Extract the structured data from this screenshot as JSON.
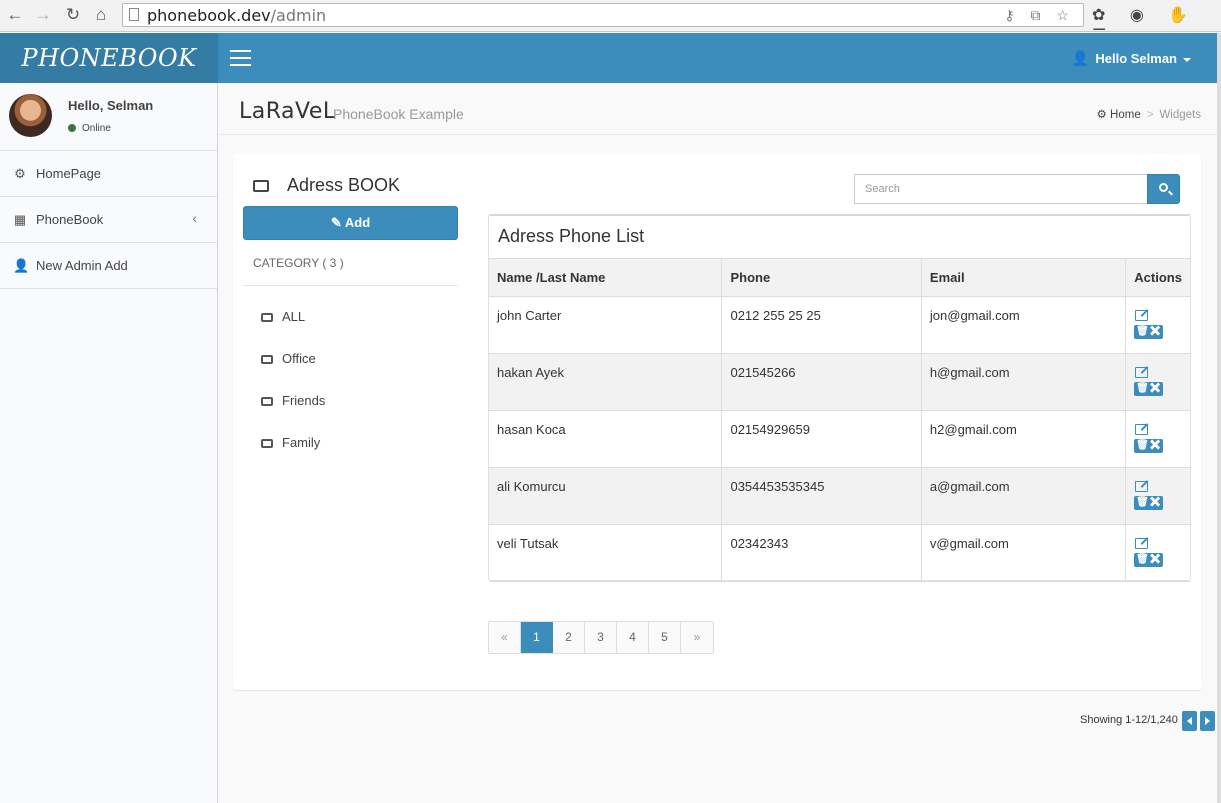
{
  "browser": {
    "url_host": "phonebook.dev",
    "url_path": "/admin",
    "back_icon": "←",
    "forward_icon": "→",
    "reload_icon": "↻",
    "home_icon": "⌂",
    "addr_icons": "⚷ ⧉ ☆",
    "ext_icons": "✿ ◉ ✋ ☰"
  },
  "header": {
    "logo": "PHONEBOOK",
    "user_greeting": "Hello Selman",
    "user_icon": "👤"
  },
  "sidebar": {
    "user_name": "Hello, Selman",
    "status": "Online",
    "items": [
      {
        "icon": "⚙",
        "label": "HomePage"
      },
      {
        "icon": "▦",
        "label": "PhoneBook",
        "chevron": "‹"
      },
      {
        "icon": "👤",
        "label": "New Admin Add"
      }
    ]
  },
  "content_header": {
    "title": "LaRaVeL",
    "subtitle": "PhoneBook Example",
    "breadcrumb_home": "Home",
    "breadcrumb_sep": ">",
    "breadcrumb_current": "Widgets"
  },
  "addressbook": {
    "title": "Adress BOOK",
    "add_label": "✎ Add",
    "category_label": "CATEGORY ( 3 )",
    "categories": [
      "ALL",
      "Office",
      "Friends",
      "Family"
    ]
  },
  "search": {
    "placeholder": "Search"
  },
  "list": {
    "title": "Adress Phone List",
    "columns": [
      "Name /Last Name",
      "Phone",
      "Email",
      "Actions"
    ],
    "rows": [
      {
        "name": "john Carter",
        "phone": "0212 255 25 25",
        "email": "jon@gmail.com"
      },
      {
        "name": "hakan Ayek",
        "phone": "021545266",
        "email": "h@gmail.com"
      },
      {
        "name": "hasan Koca",
        "phone": "02154929659",
        "email": "h2@gmail.com"
      },
      {
        "name": "ali Komurcu",
        "phone": "0354453535345",
        "email": "a@gmail.com"
      },
      {
        "name": "veli Tutsak",
        "phone": "02342343",
        "email": "v@gmail.com"
      }
    ],
    "delete_label": "🗑✖"
  },
  "pagination": {
    "prev": "«",
    "pages": [
      "1",
      "2",
      "3",
      "4",
      "5"
    ],
    "active_page": "1",
    "next": "»"
  },
  "footer": {
    "showing": "Showing 1-12/1,240"
  },
  "colors": {
    "primary": "#3c8dbc",
    "logo_bg": "#357ca5",
    "online": "#3c763d"
  }
}
